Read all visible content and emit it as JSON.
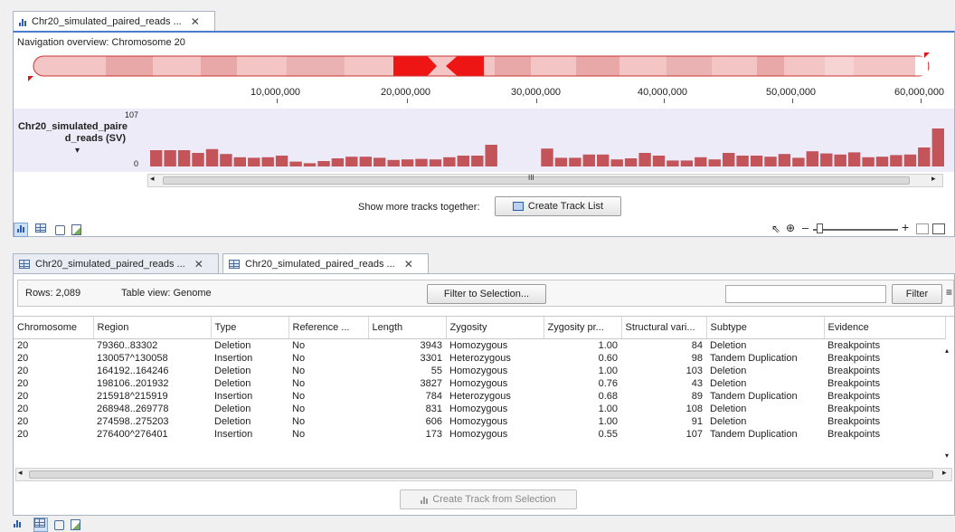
{
  "top_tab": {
    "title": "Chr20_simulated_paired_reads ...",
    "close": "✕"
  },
  "nav": {
    "label": "Navigation overview: Chromosome 20",
    "ruler_ticks": [
      "10,000,000",
      "20,000,000",
      "30,000,000",
      "40,000,000",
      "50,000,000",
      "60,000,000"
    ]
  },
  "track": {
    "name_line1": "Chr20_simulated_paire",
    "name_line2": "d_reads (SV)",
    "dropdown": "▾",
    "max": "107",
    "min": "0",
    "bars": [
      0.3,
      0.3,
      0.3,
      0.25,
      0.32,
      0.23,
      0.17,
      0.16,
      0.17,
      0.2,
      0.09,
      0.06,
      0.1,
      0.15,
      0.18,
      0.18,
      0.16,
      0.12,
      0.13,
      0.14,
      0.13,
      0.17,
      0.2,
      0.2,
      0.4,
      0.0,
      0.0,
      0.0,
      0.33,
      0.16,
      0.16,
      0.22,
      0.22,
      0.13,
      0.15,
      0.25,
      0.2,
      0.11,
      0.11,
      0.17,
      0.13,
      0.25,
      0.2,
      0.2,
      0.18,
      0.23,
      0.16,
      0.28,
      0.24,
      0.22,
      0.26,
      0.17,
      0.18,
      0.21,
      0.22,
      0.35,
      0.7
    ]
  },
  "create_track_list": {
    "prompt": "Show more tracks together:",
    "button": "Create Track List"
  },
  "view_tabs": [
    {
      "title": "Chr20_simulated_paired_reads ...",
      "close": "✕"
    },
    {
      "title": "Chr20_simulated_paired_reads ...",
      "close": "✕"
    }
  ],
  "table": {
    "rows_label": "Rows: 2,089",
    "view_label": "Table view: Genome",
    "filter_selection_button": "Filter to Selection...",
    "filter_input_value": "",
    "filter_button": "Filter",
    "columns": [
      "Chromosome",
      "Region",
      "Type",
      "Reference ...",
      "Length",
      "Zygosity",
      "Zygosity pr...",
      "Structural vari...",
      "Subtype",
      "Evidence"
    ],
    "rows": [
      [
        "20",
        "79360..83302",
        "Deletion",
        "No",
        "3943",
        "Homozygous",
        "1.00",
        "84",
        "Deletion",
        "Breakpoints"
      ],
      [
        "20",
        "130057^130058",
        "Insertion",
        "No",
        "3301",
        "Heterozygous",
        "0.60",
        "98",
        "Tandem Duplication",
        "Breakpoints"
      ],
      [
        "20",
        "164192..164246",
        "Deletion",
        "No",
        "55",
        "Homozygous",
        "1.00",
        "103",
        "Deletion",
        "Breakpoints"
      ],
      [
        "20",
        "198106..201932",
        "Deletion",
        "No",
        "3827",
        "Homozygous",
        "0.76",
        "43",
        "Deletion",
        "Breakpoints"
      ],
      [
        "20",
        "215918^215919",
        "Insertion",
        "No",
        "784",
        "Heterozygous",
        "0.68",
        "89",
        "Tandem Duplication",
        "Breakpoints"
      ],
      [
        "20",
        "268948..269778",
        "Deletion",
        "No",
        "831",
        "Homozygous",
        "1.00",
        "108",
        "Deletion",
        "Breakpoints"
      ],
      [
        "20",
        "274598..275203",
        "Deletion",
        "No",
        "606",
        "Homozygous",
        "1.00",
        "91",
        "Deletion",
        "Breakpoints"
      ],
      [
        "20",
        "276400^276401",
        "Insertion",
        "No",
        "173",
        "Homozygous",
        "0.55",
        "107",
        "Tandem Duplication",
        "Breakpoints"
      ]
    ],
    "create_track_button": "Create Track from Selection",
    "scroll_marker": "III"
  },
  "colors": {
    "bar": "#c2545a",
    "track_bg": "#ecebf7",
    "accent": "#2a5db0"
  }
}
